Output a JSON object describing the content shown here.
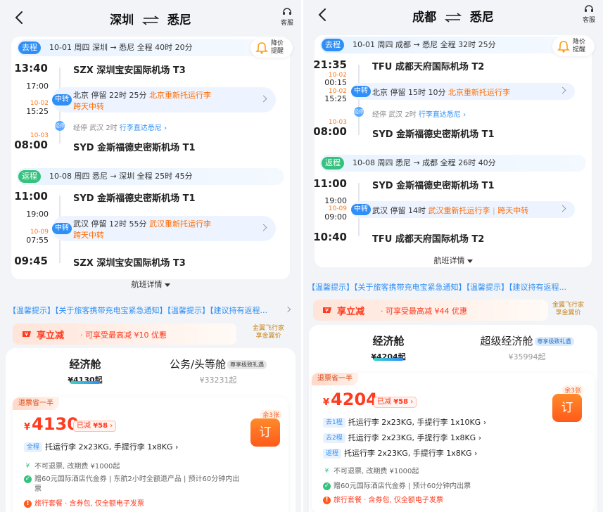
{
  "left": {
    "title_from": "深圳",
    "title_to": "悉尼",
    "support_label": "客服",
    "alert_label": "降价提醒",
    "outbound": {
      "tag": "去程",
      "summary": "10-01 周四 深圳 → 悉尼 全程 40时 20分",
      "dep_time": "13:40",
      "dep_airport": "SZX 深圳宝安国际机场 T3",
      "transfer_arr_time": "17:00",
      "transfer_date": "10-02",
      "transfer_dep_time": "15:25",
      "transfer_tag": "中转",
      "transfer_city_stop": "北京 停留 22时 25分",
      "transfer_note": "北京重新托运行李",
      "transfer_note2": "跨天中转",
      "stop_tag": "经停",
      "stop_prefix": "经停",
      "stop_text": "武汉 2时",
      "stop_link": "行李直达悉尼",
      "arr_date": "10-03",
      "arr_time": "08:00",
      "arr_airport": "SYD 金斯福德史密斯机场 T1"
    },
    "return": {
      "tag": "返程",
      "summary": "10-08 周四 悉尼 → 深圳 全程 25时 45分",
      "dep_time": "11:00",
      "dep_airport": "SYD 金斯福德史密斯机场 T1",
      "transfer_arr_time": "19:00",
      "transfer_date": "10-09",
      "transfer_dep_time": "07:55",
      "transfer_tag": "中转",
      "transfer_city_stop": "武汉 停留 12时 55分",
      "transfer_note": "武汉重新托运行李",
      "transfer_note2": "跨天中转",
      "arr_time": "09:45",
      "arr_airport": "SZX 深圳宝安国际机场 T3"
    },
    "flight_detail": "航班详情",
    "notice": "【温馨提示】【关于旅客携带充电宝紧急通知】【温馨提示】【建议持有返程...",
    "promo_title": "享立减",
    "promo_desc": "· 可享受最高减 ¥10 优惠",
    "gold_line1": "金翼飞行家",
    "gold_line2": "享金翼价",
    "cabin1_name": "经济舱",
    "cabin1_price": "¥4130起",
    "cabin2_name": "公务/头等舱",
    "cabin2_badge": "尊享极致礼遇",
    "cabin2_price": "¥33231起",
    "refund_tag": "退票省一半",
    "currency": "¥",
    "price": "4130",
    "discount_label": "已减",
    "discount_value": "¥58",
    "book_label": "订",
    "remain": "余3张",
    "bag_tag": "全程",
    "bag_text": "托运行李 2x23KG, 手提行李 1x8KG",
    "policy1": "不可退票, 改期费 ¥1000起",
    "policy2": "赠60元国际酒店代金券 | 东航2小时全额退产品 | 预计60分钟内出",
    "policy2b": "票",
    "policy3": "旅行套餐 · 含券包, 仅全额电子发票"
  },
  "right": {
    "title_from": "成都",
    "title_to": "悉尼",
    "support_label": "客服",
    "alert_label": "降价提醒",
    "outbound": {
      "tag": "去程",
      "summary": "10-01 周四 成都 → 悉尼 全程 32时 25分",
      "dep_time": "21:35",
      "dep_airport": "TFU 成都天府国际机场 T2",
      "date1": "10-02",
      "transfer_arr_time": "00:15",
      "date2": "10-02",
      "transfer_dep_time": "15:25",
      "transfer_tag": "中转",
      "transfer_city_stop": "北京 停留 15时 10分",
      "transfer_note": "北京重新托运行李",
      "stop_tag": "经停",
      "stop_prefix": "经停",
      "stop_text": "武汉 2时",
      "stop_link": "行李直达悉尼",
      "arr_date": "10-03",
      "arr_time": "08:00",
      "arr_airport": "SYD 金斯福德史密斯机场 T1"
    },
    "return": {
      "tag": "返程",
      "summary": "10-08 周四 悉尼 → 成都 全程 26时 40分",
      "dep_time": "11:00",
      "dep_airport": "SYD 金斯福德史密斯机场 T1",
      "transfer_arr_time": "19:00",
      "transfer_date": "10-09",
      "transfer_dep_time": "09:00",
      "transfer_tag": "中转",
      "transfer_city_stop": "武汉 停留 14时",
      "transfer_note": "武汉重新托运行李",
      "transfer_note2": "跨天中转",
      "arr_time": "10:40",
      "arr_airport": "TFU 成都天府国际机场 T2"
    },
    "flight_detail": "航班详情",
    "notice": "【温馨提示】【关于旅客携带充电宝紧急通知】【温馨提示】【建议持有返程...",
    "promo_title": "享立减",
    "promo_desc": "· 可享受最高减 ¥44 优惠",
    "gold_line1": "金翼飞行家",
    "gold_line2": "享金翼价",
    "cabin1_name": "经济舱",
    "cabin1_price": "¥4204起",
    "cabin2_name": "超级经济舱",
    "cabin2_badge": "尊享极致礼遇",
    "cabin2_price": "¥35994起",
    "refund_tag": "退票省一半",
    "currency": "¥",
    "price": "4204",
    "discount_label": "已减",
    "discount_value": "¥58",
    "book_label": "订",
    "remain": "余3张",
    "bag1_tag": "去1程",
    "bag1_text": "托运行李 2x23KG, 手提行李 1x10KG",
    "bag2_tag": "去2程",
    "bag2_text": "托运行李 2x23KG, 手提行李 1x8KG",
    "bag3_tag": "返程",
    "bag3_text": "托运行李 2x23KG, 手提行李 1x8KG",
    "policy1": "不可退票, 改期费 ¥1000起",
    "policy2": "赠60元国际酒店代金券 | 预计60分钟内出票",
    "policy3": "旅行套餐 · 含券包, 仅全额电子发票"
  }
}
